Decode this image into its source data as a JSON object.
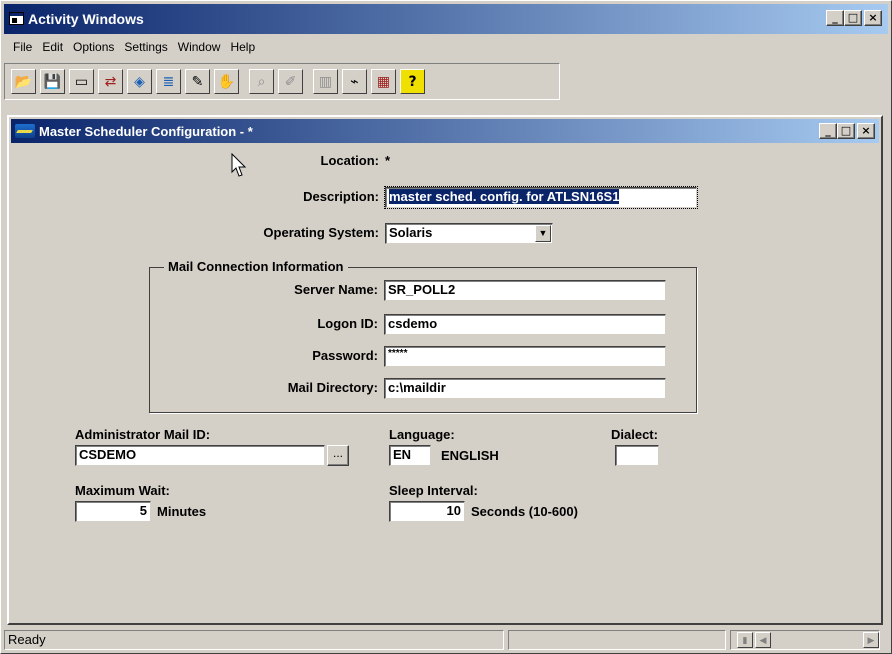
{
  "app": {
    "title": "Activity Windows",
    "window_buttons": [
      "_",
      "□",
      "×"
    ]
  },
  "menu": [
    "File",
    "Edit",
    "Options",
    "Settings",
    "Window",
    "Help"
  ],
  "toolbar": {
    "icons": [
      "open-folder-icon",
      "save-disk-icon",
      "window-icon",
      "transfer-icon",
      "network-icon",
      "list-icon",
      "edit-document-icon",
      "hand-icon",
      "search-icon",
      "edit-form-icon",
      "report-icon",
      "scheduler-icon",
      "grid-icon",
      "help-icon"
    ],
    "glyphs": [
      "📂",
      "💾",
      "▭",
      "⇄",
      "◈",
      "≣",
      "✎",
      "✋",
      "⌕",
      "✐",
      "▥",
      "⌁",
      "▦",
      "?"
    ]
  },
  "child": {
    "title": "Master Scheduler Configuration - *",
    "window_buttons": [
      "_",
      "□",
      "×"
    ]
  },
  "form": {
    "location_label": "Location:",
    "location_value": "*",
    "description_label": "Description:",
    "description_value": "master sched. config. for ATLSN16S1",
    "os_label": "Operating System:",
    "os_value": "Solaris",
    "mail_group_title": "Mail Connection Information",
    "server_label": "Server Name:",
    "server_value": "SR_POLL2",
    "logon_label": "Logon ID:",
    "logon_value": "csdemo",
    "password_label": "Password:",
    "password_value": "*****",
    "maildir_label": "Mail Directory:",
    "maildir_value": "c:\\maildir",
    "admin_label": "Administrator Mail ID:",
    "admin_value": "CSDEMO",
    "browse_label": "...",
    "language_label": "Language:",
    "language_code": "EN",
    "language_name": "ENGLISH",
    "dialect_label": "Dialect:",
    "dialect_value": "",
    "maxwait_label": "Maximum Wait:",
    "maxwait_value": "5",
    "maxwait_unit": "Minutes",
    "sleep_label": "Sleep Interval:",
    "sleep_value": "10",
    "sleep_unit": "Seconds (10-600)"
  },
  "status": {
    "text": "Ready"
  }
}
